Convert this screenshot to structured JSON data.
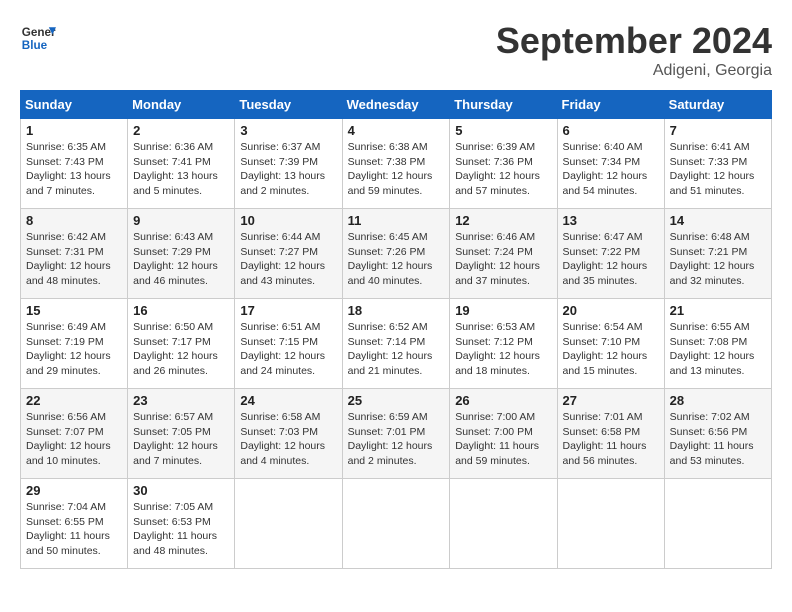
{
  "header": {
    "logo_line1": "General",
    "logo_line2": "Blue",
    "month_title": "September 2024",
    "location": "Adigeni, Georgia"
  },
  "days_of_week": [
    "Sunday",
    "Monday",
    "Tuesday",
    "Wednesday",
    "Thursday",
    "Friday",
    "Saturday"
  ],
  "weeks": [
    [
      {
        "day": "1",
        "sunrise": "Sunrise: 6:35 AM",
        "sunset": "Sunset: 7:43 PM",
        "daylight": "Daylight: 13 hours and 7 minutes."
      },
      {
        "day": "2",
        "sunrise": "Sunrise: 6:36 AM",
        "sunset": "Sunset: 7:41 PM",
        "daylight": "Daylight: 13 hours and 5 minutes."
      },
      {
        "day": "3",
        "sunrise": "Sunrise: 6:37 AM",
        "sunset": "Sunset: 7:39 PM",
        "daylight": "Daylight: 13 hours and 2 minutes."
      },
      {
        "day": "4",
        "sunrise": "Sunrise: 6:38 AM",
        "sunset": "Sunset: 7:38 PM",
        "daylight": "Daylight: 12 hours and 59 minutes."
      },
      {
        "day": "5",
        "sunrise": "Sunrise: 6:39 AM",
        "sunset": "Sunset: 7:36 PM",
        "daylight": "Daylight: 12 hours and 57 minutes."
      },
      {
        "day": "6",
        "sunrise": "Sunrise: 6:40 AM",
        "sunset": "Sunset: 7:34 PM",
        "daylight": "Daylight: 12 hours and 54 minutes."
      },
      {
        "day": "7",
        "sunrise": "Sunrise: 6:41 AM",
        "sunset": "Sunset: 7:33 PM",
        "daylight": "Daylight: 12 hours and 51 minutes."
      }
    ],
    [
      {
        "day": "8",
        "sunrise": "Sunrise: 6:42 AM",
        "sunset": "Sunset: 7:31 PM",
        "daylight": "Daylight: 12 hours and 48 minutes."
      },
      {
        "day": "9",
        "sunrise": "Sunrise: 6:43 AM",
        "sunset": "Sunset: 7:29 PM",
        "daylight": "Daylight: 12 hours and 46 minutes."
      },
      {
        "day": "10",
        "sunrise": "Sunrise: 6:44 AM",
        "sunset": "Sunset: 7:27 PM",
        "daylight": "Daylight: 12 hours and 43 minutes."
      },
      {
        "day": "11",
        "sunrise": "Sunrise: 6:45 AM",
        "sunset": "Sunset: 7:26 PM",
        "daylight": "Daylight: 12 hours and 40 minutes."
      },
      {
        "day": "12",
        "sunrise": "Sunrise: 6:46 AM",
        "sunset": "Sunset: 7:24 PM",
        "daylight": "Daylight: 12 hours and 37 minutes."
      },
      {
        "day": "13",
        "sunrise": "Sunrise: 6:47 AM",
        "sunset": "Sunset: 7:22 PM",
        "daylight": "Daylight: 12 hours and 35 minutes."
      },
      {
        "day": "14",
        "sunrise": "Sunrise: 6:48 AM",
        "sunset": "Sunset: 7:21 PM",
        "daylight": "Daylight: 12 hours and 32 minutes."
      }
    ],
    [
      {
        "day": "15",
        "sunrise": "Sunrise: 6:49 AM",
        "sunset": "Sunset: 7:19 PM",
        "daylight": "Daylight: 12 hours and 29 minutes."
      },
      {
        "day": "16",
        "sunrise": "Sunrise: 6:50 AM",
        "sunset": "Sunset: 7:17 PM",
        "daylight": "Daylight: 12 hours and 26 minutes."
      },
      {
        "day": "17",
        "sunrise": "Sunrise: 6:51 AM",
        "sunset": "Sunset: 7:15 PM",
        "daylight": "Daylight: 12 hours and 24 minutes."
      },
      {
        "day": "18",
        "sunrise": "Sunrise: 6:52 AM",
        "sunset": "Sunset: 7:14 PM",
        "daylight": "Daylight: 12 hours and 21 minutes."
      },
      {
        "day": "19",
        "sunrise": "Sunrise: 6:53 AM",
        "sunset": "Sunset: 7:12 PM",
        "daylight": "Daylight: 12 hours and 18 minutes."
      },
      {
        "day": "20",
        "sunrise": "Sunrise: 6:54 AM",
        "sunset": "Sunset: 7:10 PM",
        "daylight": "Daylight: 12 hours and 15 minutes."
      },
      {
        "day": "21",
        "sunrise": "Sunrise: 6:55 AM",
        "sunset": "Sunset: 7:08 PM",
        "daylight": "Daylight: 12 hours and 13 minutes."
      }
    ],
    [
      {
        "day": "22",
        "sunrise": "Sunrise: 6:56 AM",
        "sunset": "Sunset: 7:07 PM",
        "daylight": "Daylight: 12 hours and 10 minutes."
      },
      {
        "day": "23",
        "sunrise": "Sunrise: 6:57 AM",
        "sunset": "Sunset: 7:05 PM",
        "daylight": "Daylight: 12 hours and 7 minutes."
      },
      {
        "day": "24",
        "sunrise": "Sunrise: 6:58 AM",
        "sunset": "Sunset: 7:03 PM",
        "daylight": "Daylight: 12 hours and 4 minutes."
      },
      {
        "day": "25",
        "sunrise": "Sunrise: 6:59 AM",
        "sunset": "Sunset: 7:01 PM",
        "daylight": "Daylight: 12 hours and 2 minutes."
      },
      {
        "day": "26",
        "sunrise": "Sunrise: 7:00 AM",
        "sunset": "Sunset: 7:00 PM",
        "daylight": "Daylight: 11 hours and 59 minutes."
      },
      {
        "day": "27",
        "sunrise": "Sunrise: 7:01 AM",
        "sunset": "Sunset: 6:58 PM",
        "daylight": "Daylight: 11 hours and 56 minutes."
      },
      {
        "day": "28",
        "sunrise": "Sunrise: 7:02 AM",
        "sunset": "Sunset: 6:56 PM",
        "daylight": "Daylight: 11 hours and 53 minutes."
      }
    ],
    [
      {
        "day": "29",
        "sunrise": "Sunrise: 7:04 AM",
        "sunset": "Sunset: 6:55 PM",
        "daylight": "Daylight: 11 hours and 50 minutes."
      },
      {
        "day": "30",
        "sunrise": "Sunrise: 7:05 AM",
        "sunset": "Sunset: 6:53 PM",
        "daylight": "Daylight: 11 hours and 48 minutes."
      },
      null,
      null,
      null,
      null,
      null
    ]
  ]
}
